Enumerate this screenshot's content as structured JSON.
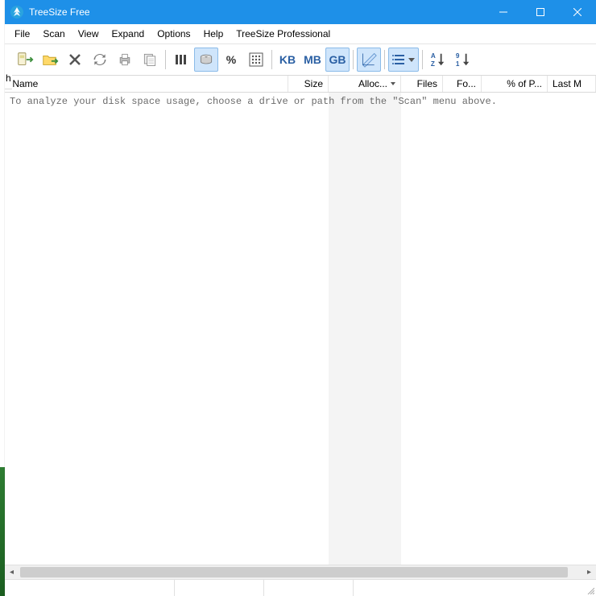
{
  "window": {
    "title": "TreeSize Free"
  },
  "menu": [
    "File",
    "Scan",
    "View",
    "Expand",
    "Options",
    "Help",
    "TreeSize Professional"
  ],
  "toolbar": {
    "kb": "KB",
    "mb": "MB",
    "gb": "GB",
    "percent": "%"
  },
  "columns": {
    "name": "Name",
    "size": "Size",
    "alloc": "Alloc...",
    "files": "Files",
    "folders": "Fo...",
    "pct": "% of P...",
    "lastm": "Last M"
  },
  "body": {
    "hint": "To analyze your disk space usage, choose a drive or path from the \"Scan\" menu above."
  },
  "left_header_char": "h"
}
